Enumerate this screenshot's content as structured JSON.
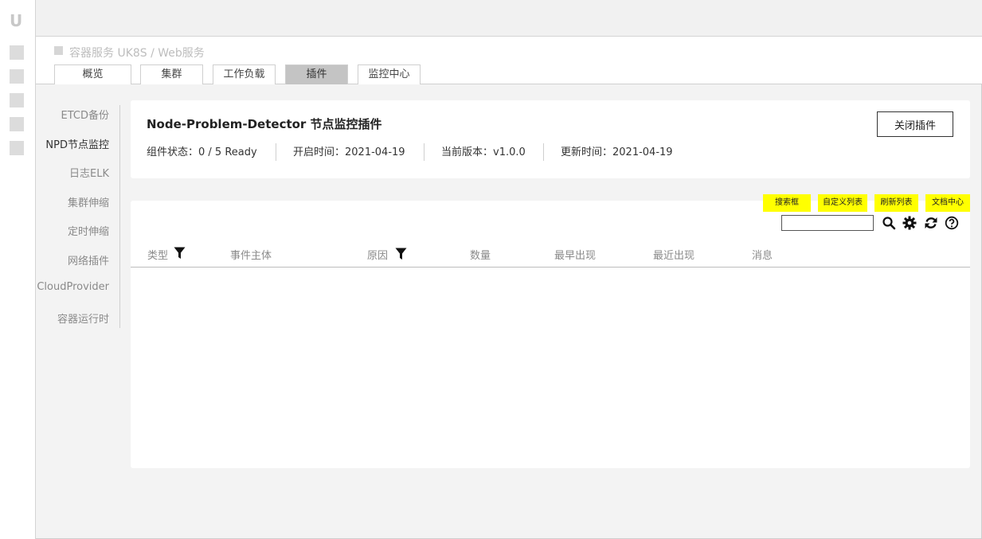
{
  "rail": {
    "logo": "U"
  },
  "breadcrumb": {
    "text": "容器服务 UK8S / Web服务"
  },
  "tabs": [
    {
      "label": "概览"
    },
    {
      "label": "集群"
    },
    {
      "label": "工作负载"
    },
    {
      "label": "插件",
      "active": true
    },
    {
      "label": "监控中心"
    }
  ],
  "subnav": [
    {
      "label": "ETCD备份"
    },
    {
      "label": "NPD节点监控",
      "active": true
    },
    {
      "label": "日志ELK"
    },
    {
      "label": "集群伸缩"
    },
    {
      "label": "定时伸缩"
    },
    {
      "label": "网络插件"
    },
    {
      "label": "CloudProvider"
    },
    {
      "label": "容器运行时"
    }
  ],
  "plugin": {
    "title": "Node-Problem-Detector 节点监控插件",
    "close_label": "关闭插件",
    "status": "组件状态：0 / 5 Ready",
    "start_time": "开启时间：2021-04-19",
    "version": "当前版本：v1.0.0",
    "update_time": "更新时间：2021-04-19"
  },
  "annotations": {
    "search": "搜索框",
    "custom_columns": "自定义列表",
    "refresh": "刷新列表",
    "docs": "文档中心"
  },
  "table": {
    "columns": [
      "类型",
      "事件主体",
      "原因",
      "数量",
      "最早出现",
      "最近出现",
      "消息"
    ],
    "rows": []
  },
  "icons": {
    "search": "search-icon",
    "settings": "gear-icon",
    "refresh": "refresh-icon",
    "help": "help-icon",
    "filter": "filter-icon"
  },
  "colors": {
    "annotation_bg": "#ffff00",
    "active_tab": "#c4c4c4"
  }
}
